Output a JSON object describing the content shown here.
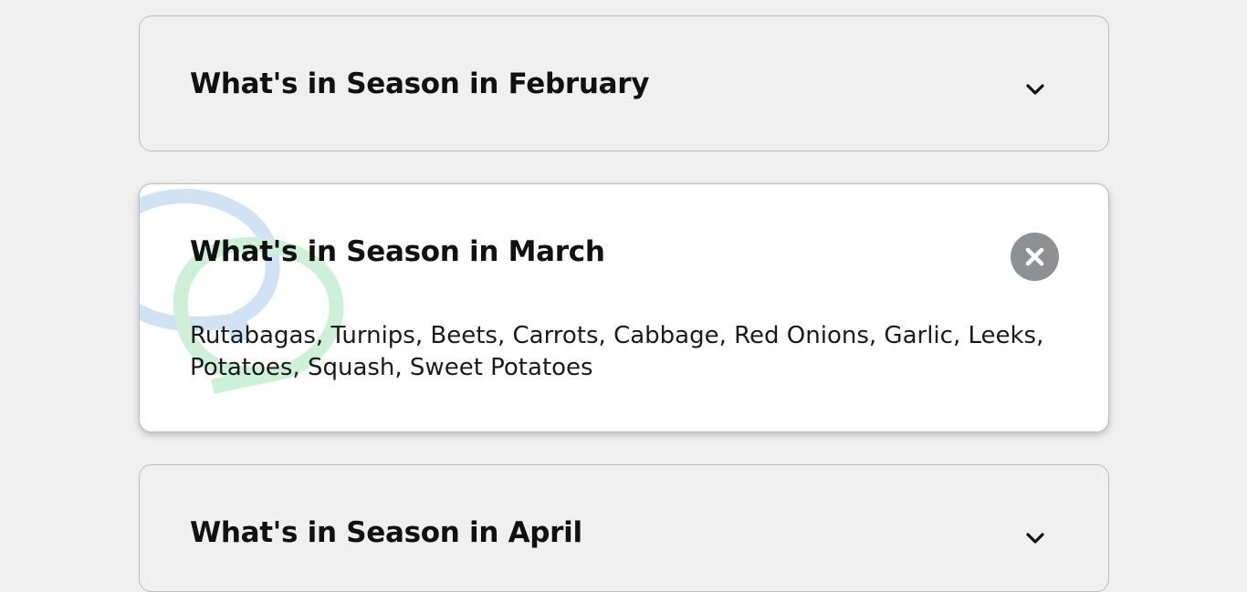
{
  "faqs": [
    {
      "title": "What's in Season in February",
      "state": "collapsed",
      "toggle_icon": "chevron-down-icon"
    },
    {
      "title": "What's in Season in March",
      "state": "expanded",
      "toggle_icon": "close-icon",
      "body": "Rutabagas, Turnips, Beets, Carrots, Cabbage, Red Onions, Garlic, Leeks, Potatoes, Squash, Sweet Potatoes"
    },
    {
      "title": "What's in Season in April",
      "state": "collapsed",
      "toggle_icon": "chevron-down-icon"
    }
  ],
  "colors": {
    "page_background": "#f0f0f0",
    "expanded_background": "#ffffff",
    "close_button": "#8f9091",
    "watermark_blue": "#cfe3f5",
    "watermark_green": "#cdf0d8"
  }
}
